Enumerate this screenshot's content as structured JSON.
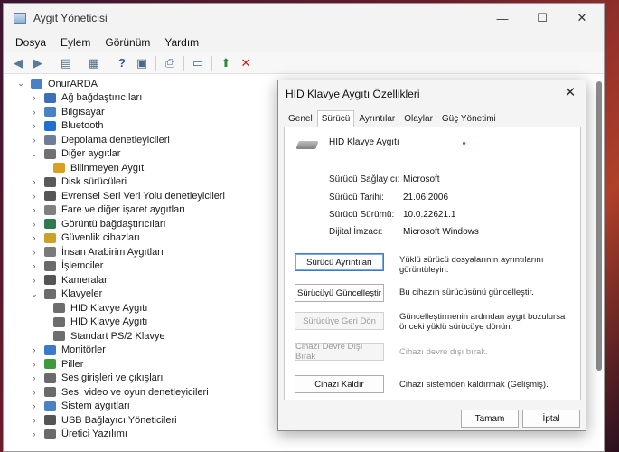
{
  "window": {
    "title": "Aygıt Yöneticisi",
    "controls": {
      "minimize": "—",
      "maximize": "☐",
      "close": "✕"
    }
  },
  "menu": [
    "Dosya",
    "Eylem",
    "Görünüm",
    "Yardım"
  ],
  "toolbar_icons": [
    "back-arrow-icon",
    "forward-arrow-icon",
    "properties-icon",
    "update-icon",
    "help-icon",
    "view-icon",
    "print-icon",
    "scan-hardware-icon",
    "enable-device-icon",
    "uninstall-icon"
  ],
  "tree": {
    "root": "OnurARDA",
    "items": [
      {
        "label": "Ağ bağdaştırıcıları",
        "icon": "network-adapter-icon",
        "color": "#3b6fb6"
      },
      {
        "label": "Bilgisayar",
        "icon": "computer-icon",
        "color": "#4a80c4"
      },
      {
        "label": "Bluetooth",
        "icon": "bluetooth-icon",
        "color": "#1f6fd0"
      },
      {
        "label": "Depolama denetleyicileri",
        "icon": "storage-icon",
        "color": "#6d7f96"
      },
      {
        "label": "Diğer aygıtlar",
        "icon": "other-devices-icon",
        "color": "#707070"
      },
      {
        "label": "Bilinmeyen Aygıt",
        "icon": "unknown-device-warning-icon",
        "color": "#d9a020"
      },
      {
        "label": "Disk sürücüleri",
        "icon": "disk-drive-icon",
        "color": "#5a5a5a"
      },
      {
        "label": "Evrensel Seri Veri Yolu denetleyicileri",
        "icon": "usb-controller-icon",
        "color": "#555555"
      },
      {
        "label": "Fare ve diğer işaret aygıtları",
        "icon": "mouse-icon",
        "color": "#808080"
      },
      {
        "label": "Görüntü bağdaştırıcıları",
        "icon": "display-adapter-icon",
        "color": "#2f7a4f"
      },
      {
        "label": "Güvenlik cihazları",
        "icon": "security-device-icon",
        "color": "#c9a227"
      },
      {
        "label": "İnsan Arabirim Aygıtları",
        "icon": "hid-icon",
        "color": "#7a7a7a"
      },
      {
        "label": "İşlemciler",
        "icon": "processor-icon",
        "color": "#6a6a6a"
      },
      {
        "label": "Kameralar",
        "icon": "camera-icon",
        "color": "#555555"
      },
      {
        "label": "Klavyeler",
        "icon": "keyboard-icon",
        "color": "#6d6d6d"
      },
      {
        "label": "HID Klavye Aygıtı",
        "icon": "keyboard-icon",
        "color": "#6d6d6d"
      },
      {
        "label": "HID Klavye Aygıtı",
        "icon": "keyboard-icon",
        "color": "#6d6d6d"
      },
      {
        "label": "Standart PS/2 Klavye",
        "icon": "keyboard-icon",
        "color": "#6d6d6d"
      },
      {
        "label": "Monitörler",
        "icon": "monitor-icon",
        "color": "#3b7ac9"
      },
      {
        "label": "Piller",
        "icon": "battery-icon",
        "color": "#3d9a3d"
      },
      {
        "label": "Ses girişleri ve çıkışları",
        "icon": "audio-io-icon",
        "color": "#6a6a6a"
      },
      {
        "label": "Ses, video ve oyun denetleyicileri",
        "icon": "sound-controller-icon",
        "color": "#6a6a6a"
      },
      {
        "label": "Sistem aygıtları",
        "icon": "system-devices-icon",
        "color": "#4a80c4"
      },
      {
        "label": "USB Bağlayıcı Yöneticileri",
        "icon": "usb-connector-icon",
        "color": "#555555"
      },
      {
        "label": "Üretici Yazılımı",
        "icon": "firmware-icon",
        "color": "#6a6a6a"
      }
    ]
  },
  "dialog": {
    "title": "HID Klavye Aygıtı Özellikleri",
    "close": "✕",
    "tabs": [
      "Genel",
      "Sürücü",
      "Ayrıntılar",
      "Olaylar",
      "Güç Yönetimi"
    ],
    "device_name": "HID Klavye Aygıtı",
    "props": [
      {
        "label": "Sürücü Sağlayıcı:",
        "value": "Microsoft"
      },
      {
        "label": "Sürücü Tarihi:",
        "value": "21.06.2006"
      },
      {
        "label": "Sürücü Sürümü:",
        "value": "10.0.22621.1"
      },
      {
        "label": "Dijital İmzacı:",
        "value": "Microsoft Windows"
      }
    ],
    "actions": [
      {
        "button": "Sürücü Ayrıntıları",
        "desc": "Yüklü sürücü dosyalarının ayrıntılarını görüntüleyin."
      },
      {
        "button": "Sürücüyü Güncelleştir",
        "desc": "Bu cihazın sürücüsünü güncelleştir."
      },
      {
        "button": "Sürücüye Geri Dön",
        "desc": "Güncelleştirmenin ardından aygıt bozulursa önceki yüklü sürücüye dönün."
      },
      {
        "button": "Cihazı Devre Dışı Bırak",
        "desc": "Cihazı devre dışı bırak."
      },
      {
        "button": "Cihazı Kaldır",
        "desc": "Cihazı sistemden kaldırmak (Gelişmiş)."
      }
    ],
    "ok": "Tamam",
    "cancel": "İptal"
  }
}
